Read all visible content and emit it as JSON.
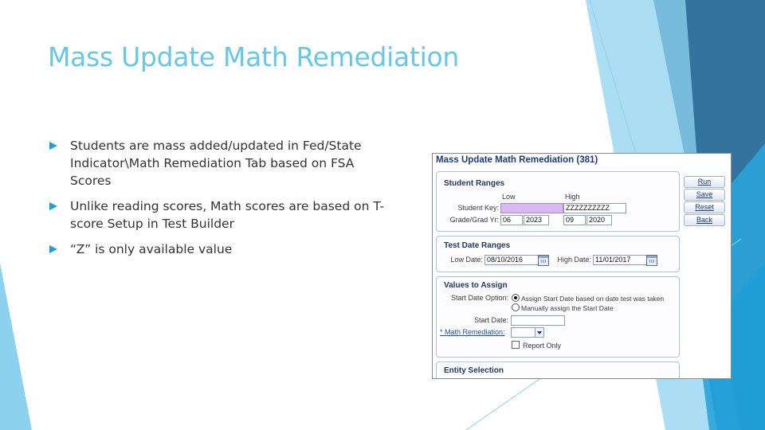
{
  "slide": {
    "title": "Mass Update Math Remediation",
    "bullets": [
      "Students are mass added/updated in Fed/State Indicator\\Math Remediation Tab based on FSA Scores",
      "Unlike reading scores, Math scores are based on T-score Setup in Test Builder",
      "“Z” is only available value"
    ]
  },
  "colors": {
    "title": "#67c8e6",
    "bullet": "#1f9ed6",
    "deco_dark": "#2a6c9a",
    "deco_mid": "#2aa3d8",
    "deco_light": "#8fd3f0"
  },
  "panel": {
    "title": "Mass Update Math Remediation (381)",
    "buttons": [
      "Run",
      "Save",
      "Reset",
      "Back"
    ],
    "student_ranges": {
      "title": "Student Ranges",
      "low_header": "Low",
      "high_header": "High",
      "student_key_label": "Student Key:",
      "student_key_low": "",
      "student_key_high": "ZZZZZZZZZZ",
      "grade_label": "Grade/Grad Yr:",
      "grade_low": "06",
      "grad_yr_low": "2023",
      "grade_high": "09",
      "grad_yr_high": "2020"
    },
    "test_date_ranges": {
      "title": "Test Date Ranges",
      "low_date_label": "Low Date:",
      "low_date": "08/10/2016",
      "high_date_label": "High Date:",
      "high_date": "11/01/2017"
    },
    "values_to_assign": {
      "title": "Values to Assign",
      "start_date_option_label": "Start Date Option:",
      "option_1": "Assign Start Date based on date test was taken",
      "option_2": "Manually assign the Start Date",
      "start_date_label": "Start Date:",
      "start_date": "",
      "math_remediation_label": "* Math Remediation:",
      "math_remediation_value": "",
      "report_only_label": "Report Only"
    },
    "entity_selection": {
      "title": "Entity Selection"
    }
  }
}
